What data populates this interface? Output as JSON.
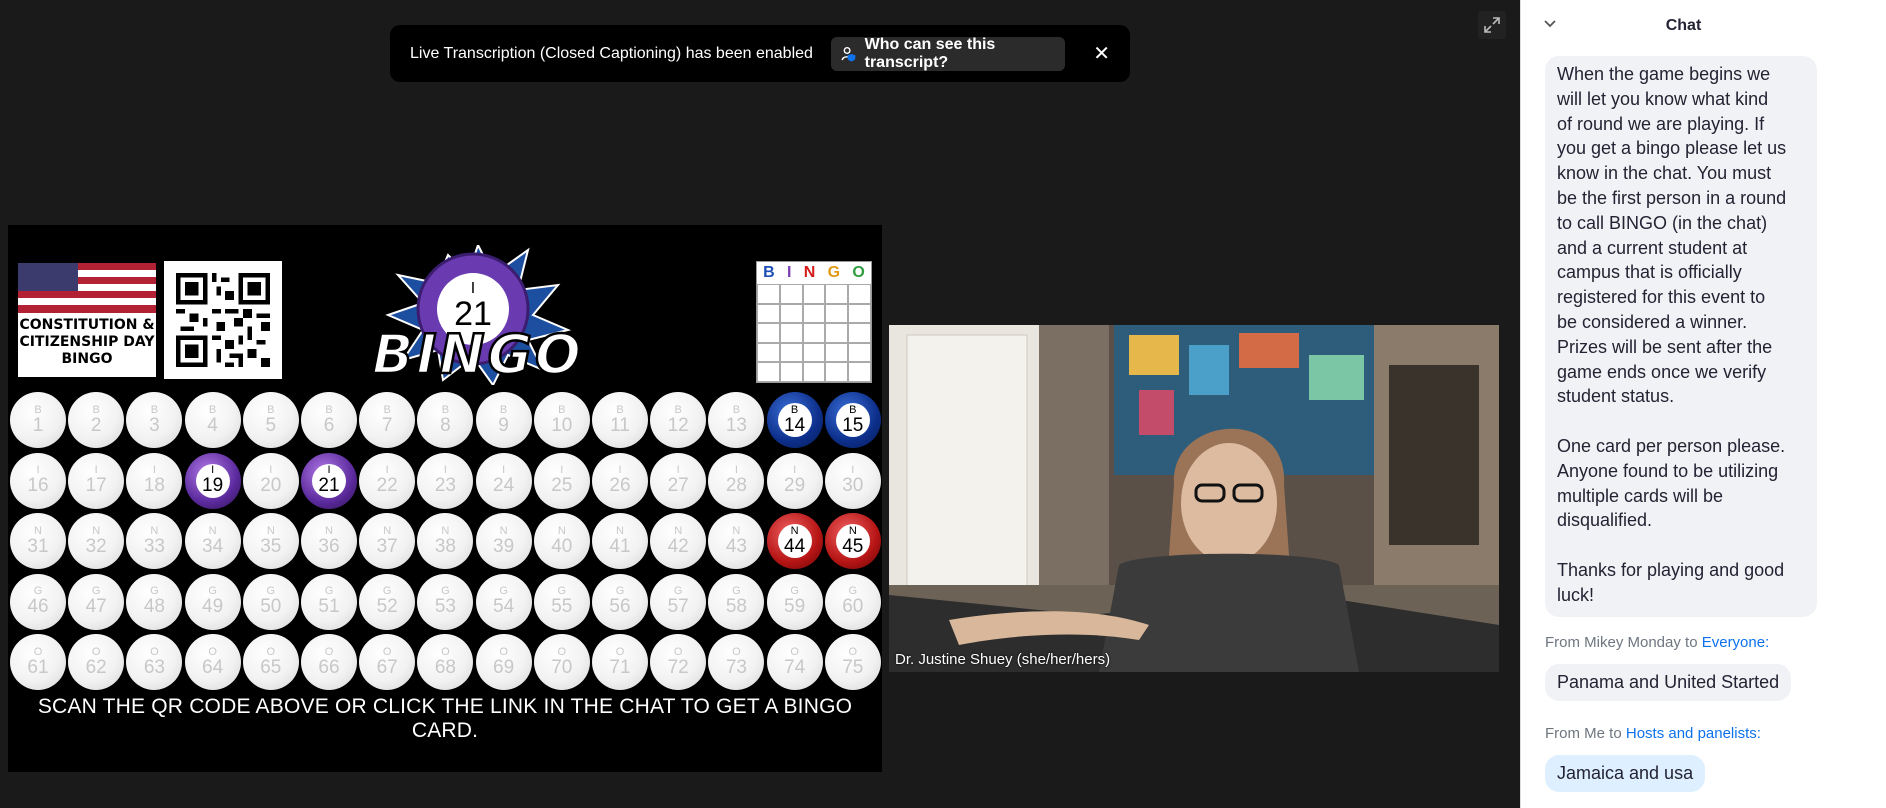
{
  "toast": {
    "message": "Live Transcription (Closed Captioning) has been enabled",
    "who_label": "Who can see this transcript?",
    "close_glyph": "✕"
  },
  "icons": {
    "expand": "expand-icon",
    "person_shield": "person-shield-icon",
    "chevron": "chevron-down-icon"
  },
  "board": {
    "event_title": "CONSTITUTION & CITIZENSHIP DAY BINGO",
    "current_call": {
      "letter": "I",
      "number": "21"
    },
    "logo_text": "BINGO",
    "card_header": [
      "B",
      "I",
      "N",
      "G",
      "O"
    ],
    "card_header_colors": [
      "#1f4fb6",
      "#7b3fb3",
      "#d51c1c",
      "#e09a18",
      "#2e9e3e"
    ],
    "rows": [
      {
        "letter": "B",
        "numbers": [
          "1",
          "2",
          "3",
          "4",
          "5",
          "6",
          "7",
          "8",
          "9",
          "10",
          "11",
          "12",
          "13",
          "14",
          "15"
        ],
        "called": [
          "14",
          "15"
        ]
      },
      {
        "letter": "I",
        "numbers": [
          "16",
          "17",
          "18",
          "19",
          "20",
          "21",
          "22",
          "23",
          "24",
          "25",
          "26",
          "27",
          "28",
          "29",
          "30"
        ],
        "called": [
          "19",
          "21"
        ]
      },
      {
        "letter": "N",
        "numbers": [
          "31",
          "32",
          "33",
          "34",
          "35",
          "36",
          "37",
          "38",
          "39",
          "40",
          "41",
          "42",
          "43",
          "44",
          "45"
        ],
        "called": [
          "44",
          "45"
        ]
      },
      {
        "letter": "G",
        "numbers": [
          "46",
          "47",
          "48",
          "49",
          "50",
          "51",
          "52",
          "53",
          "54",
          "55",
          "56",
          "57",
          "58",
          "59",
          "60"
        ],
        "called": []
      },
      {
        "letter": "O",
        "numbers": [
          "61",
          "62",
          "63",
          "64",
          "65",
          "66",
          "67",
          "68",
          "69",
          "70",
          "71",
          "72",
          "73",
          "74",
          "75"
        ],
        "called": []
      }
    ],
    "instruction": "SCAN THE QR CODE ABOVE OR CLICK THE LINK IN THE CHAT TO GET A BINGO CARD."
  },
  "video": {
    "participant_name": "Dr. Justine Shuey (she/her/hers)"
  },
  "chat": {
    "title": "Chat",
    "messages": [
      {
        "lines": [
          "When the game begins we",
          "will let you know what kind",
          "of round we are playing. If",
          "you get a bingo please let us",
          "know in the chat. You must",
          "be the first person in a round",
          "to call BINGO  (in the chat)",
          "and a current student at",
          "campus that is officially",
          "registered for this event to",
          "be considered a winner.",
          "Prizes will be sent after the",
          "game ends once we verify",
          "student status.",
          "",
          "One card per person please.",
          "Anyone found to be utilizing",
          "multiple cards will be",
          "disqualified.",
          "",
          "Thanks for playing and good",
          "luck!"
        ]
      },
      {
        "from_prefix": "From Mikey Monday to ",
        "to": "Everyone:",
        "text": "Panama and United Started"
      },
      {
        "from_prefix": "From Me to ",
        "to": "Hosts and panelists:",
        "text": "Jamaica and usa"
      }
    ]
  }
}
